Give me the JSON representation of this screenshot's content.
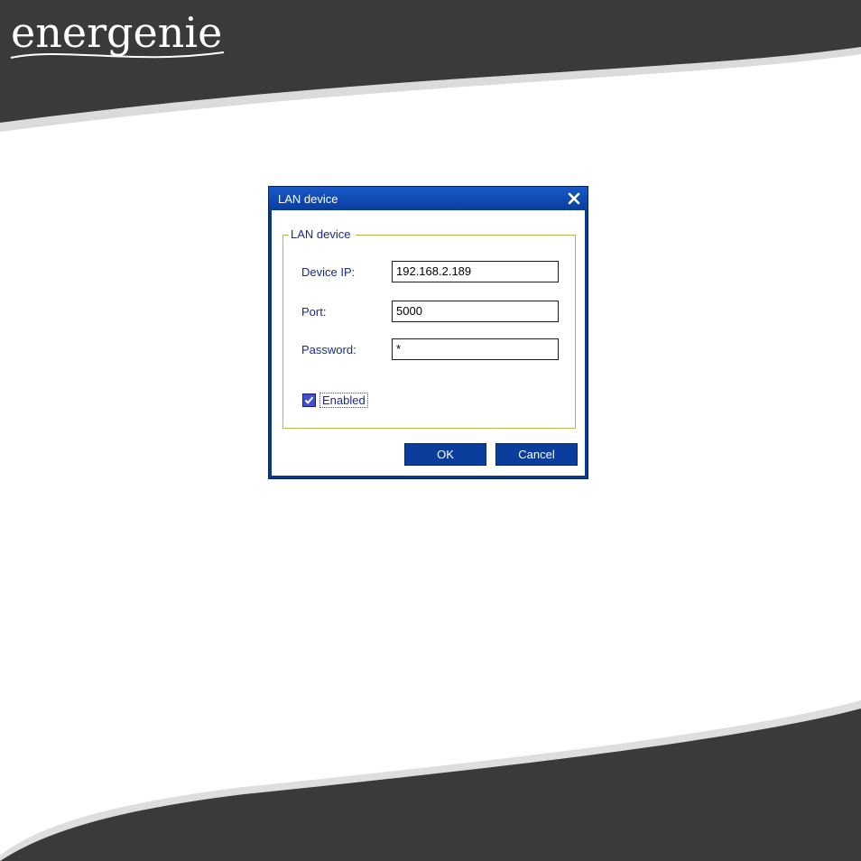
{
  "brand": {
    "logo_text": "energenie"
  },
  "dialog": {
    "title": "LAN device",
    "close_label": "X",
    "group_label": "LAN device",
    "fields": {
      "device_ip": {
        "label": "Device IP:",
        "value": "192.168.2.189"
      },
      "port": {
        "label": "Port:",
        "value": "5000"
      },
      "password": {
        "label": "Password:",
        "value": "*"
      }
    },
    "enabled": {
      "label": "Enabled",
      "checked": true
    },
    "ok_label": "OK",
    "cancel_label": "Cancel"
  },
  "colors": {
    "band": "#3a3a3a",
    "dialog_blue": "#0b3d9c",
    "label_text": "#1a2a8a",
    "group_border": "#b5b84a"
  }
}
